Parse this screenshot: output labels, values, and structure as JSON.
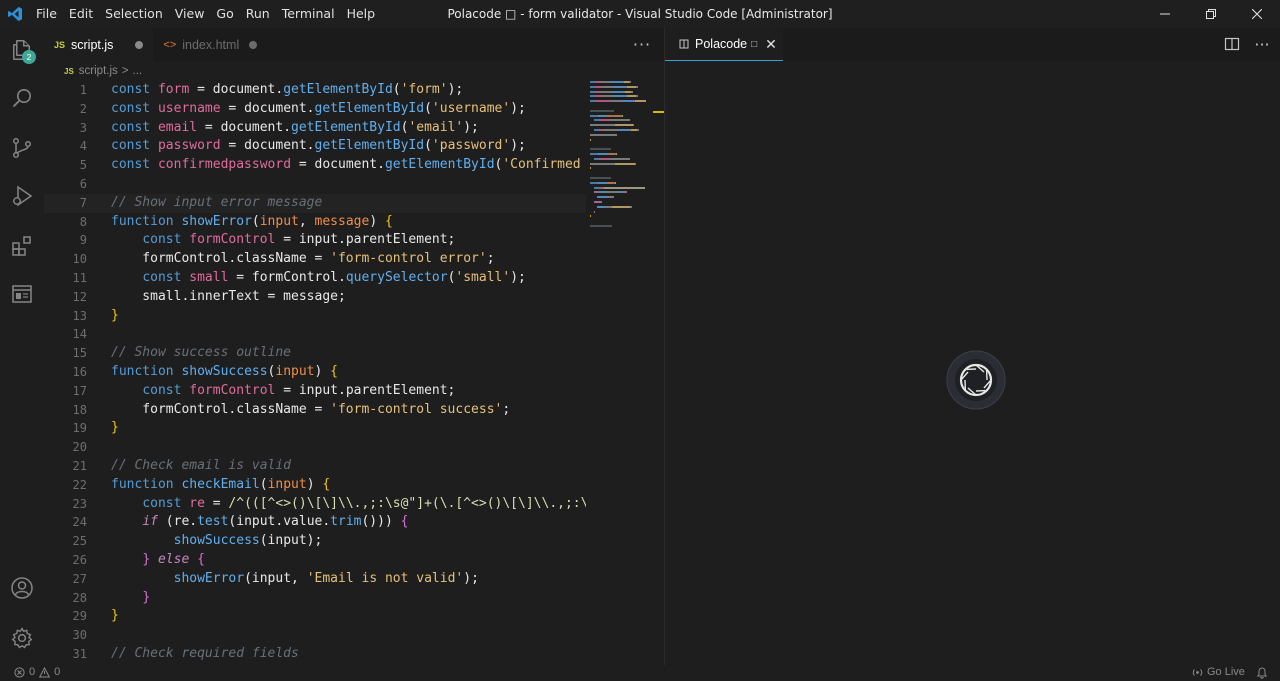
{
  "titlebar": {
    "menu": [
      "File",
      "Edit",
      "Selection",
      "View",
      "Go",
      "Run",
      "Terminal",
      "Help"
    ],
    "window_title": "Polacode □ - form validator - Visual Studio Code [Administrator]"
  },
  "activitybar": {
    "explorer_badge": "2",
    "icons": [
      "explorer-icon",
      "search-icon",
      "source-control-icon",
      "run-debug-icon",
      "extensions-icon",
      "remote-explorer-icon",
      "account-icon",
      "settings-gear-icon"
    ]
  },
  "editor_group_1": {
    "tabs": [
      {
        "glyph": "JS",
        "label": "script.js",
        "active": true,
        "modified": true
      },
      {
        "glyph": "<>",
        "label": "index.html",
        "active": false,
        "modified": true
      }
    ],
    "more_label": "···",
    "breadcrumb": {
      "glyph": "JS",
      "file": "script.js",
      "sep": ">",
      "rest": "..."
    },
    "code_lines": [
      {
        "n": "1",
        "tokens": [
          [
            "kw",
            "const "
          ],
          [
            "var",
            "form"
          ],
          [
            "plain",
            " = document."
          ],
          [
            "fn",
            "getElementById"
          ],
          [
            "plain",
            "("
          ],
          [
            "str",
            "'form'"
          ],
          [
            "plain",
            ");"
          ]
        ]
      },
      {
        "n": "2",
        "tokens": [
          [
            "kw",
            "const "
          ],
          [
            "var",
            "username"
          ],
          [
            "plain",
            " = document."
          ],
          [
            "fn",
            "getElementById"
          ],
          [
            "plain",
            "("
          ],
          [
            "str",
            "'username'"
          ],
          [
            "plain",
            ");"
          ]
        ]
      },
      {
        "n": "3",
        "tokens": [
          [
            "kw",
            "const "
          ],
          [
            "var",
            "email"
          ],
          [
            "plain",
            " = document."
          ],
          [
            "fn",
            "getElementById"
          ],
          [
            "plain",
            "("
          ],
          [
            "str",
            "'email'"
          ],
          [
            "plain",
            ");"
          ]
        ]
      },
      {
        "n": "4",
        "tokens": [
          [
            "kw",
            "const "
          ],
          [
            "var",
            "password"
          ],
          [
            "plain",
            " = document."
          ],
          [
            "fn",
            "getElementById"
          ],
          [
            "plain",
            "("
          ],
          [
            "str",
            "'password'"
          ],
          [
            "plain",
            ");"
          ]
        ]
      },
      {
        "n": "5",
        "tokens": [
          [
            "kw",
            "const "
          ],
          [
            "var",
            "confirmedpassword"
          ],
          [
            "plain",
            " = document."
          ],
          [
            "fn",
            "getElementById"
          ],
          [
            "plain",
            "("
          ],
          [
            "str",
            "'Confirmed p"
          ]
        ]
      },
      {
        "n": "6",
        "tokens": []
      },
      {
        "n": "7",
        "current": true,
        "tokens": [
          [
            "cmt",
            "// Show input error message"
          ]
        ]
      },
      {
        "n": "8",
        "tokens": [
          [
            "kw",
            "function "
          ],
          [
            "fn",
            "showError"
          ],
          [
            "plain",
            "("
          ],
          [
            "param",
            "input"
          ],
          [
            "plain",
            ", "
          ],
          [
            "param",
            "message"
          ],
          [
            "plain",
            ") "
          ],
          [
            "brace",
            "{"
          ]
        ]
      },
      {
        "n": "9",
        "tokens": [
          [
            "plain",
            "    "
          ],
          [
            "kw",
            "const "
          ],
          [
            "var",
            "formControl"
          ],
          [
            "plain",
            " = input.parentElement;"
          ]
        ]
      },
      {
        "n": "10",
        "tokens": [
          [
            "plain",
            "    formControl.className = "
          ],
          [
            "str",
            "'form-control error'"
          ],
          [
            "plain",
            ";"
          ]
        ]
      },
      {
        "n": "11",
        "tokens": [
          [
            "plain",
            "    "
          ],
          [
            "kw",
            "const "
          ],
          [
            "var",
            "small"
          ],
          [
            "plain",
            " = formControl."
          ],
          [
            "fn",
            "querySelector"
          ],
          [
            "plain",
            "("
          ],
          [
            "str",
            "'small'"
          ],
          [
            "plain",
            ");"
          ]
        ]
      },
      {
        "n": "12",
        "tokens": [
          [
            "plain",
            "    small.innerText = message;"
          ]
        ]
      },
      {
        "n": "13",
        "tokens": [
          [
            "brace",
            "}"
          ]
        ]
      },
      {
        "n": "14",
        "tokens": []
      },
      {
        "n": "15",
        "tokens": [
          [
            "cmt",
            "// Show success outline"
          ]
        ]
      },
      {
        "n": "16",
        "tokens": [
          [
            "kw",
            "function "
          ],
          [
            "fn",
            "showSuccess"
          ],
          [
            "plain",
            "("
          ],
          [
            "param",
            "input"
          ],
          [
            "plain",
            ") "
          ],
          [
            "brace",
            "{"
          ]
        ]
      },
      {
        "n": "17",
        "tokens": [
          [
            "plain",
            "    "
          ],
          [
            "kw",
            "const "
          ],
          [
            "var",
            "formControl"
          ],
          [
            "plain",
            " = input.parentElement;"
          ]
        ]
      },
      {
        "n": "18",
        "tokens": [
          [
            "plain",
            "    formControl.className = "
          ],
          [
            "str",
            "'form-control success'"
          ],
          [
            "plain",
            ";"
          ]
        ]
      },
      {
        "n": "19",
        "tokens": [
          [
            "brace",
            "}"
          ]
        ]
      },
      {
        "n": "20",
        "tokens": []
      },
      {
        "n": "21",
        "tokens": [
          [
            "cmt",
            "// Check email is valid"
          ]
        ]
      },
      {
        "n": "22",
        "tokens": [
          [
            "kw",
            "function "
          ],
          [
            "fn",
            "checkEmail"
          ],
          [
            "plain",
            "("
          ],
          [
            "param",
            "input"
          ],
          [
            "plain",
            ") "
          ],
          [
            "brace",
            "{"
          ]
        ]
      },
      {
        "n": "23",
        "tokens": [
          [
            "plain",
            "    "
          ],
          [
            "kw",
            "const "
          ],
          [
            "var",
            "re"
          ],
          [
            "plain",
            " = "
          ],
          [
            "regex",
            "/^(([^<>()\\[\\]\\\\.,;:\\s@\"]+(\\.[^<>()\\[\\]\\\\.,;:\\"
          ]
        ]
      },
      {
        "n": "24",
        "tokens": [
          [
            "plain",
            "    "
          ],
          [
            "ctl",
            "if "
          ],
          [
            "plain",
            "(re."
          ],
          [
            "fn",
            "test"
          ],
          [
            "plain",
            "(input.value."
          ],
          [
            "fn",
            "trim"
          ],
          [
            "plain",
            "())) "
          ],
          [
            "brace2",
            "{"
          ]
        ]
      },
      {
        "n": "25",
        "tokens": [
          [
            "plain",
            "        "
          ],
          [
            "fn",
            "showSuccess"
          ],
          [
            "plain",
            "(input);"
          ]
        ]
      },
      {
        "n": "26",
        "tokens": [
          [
            "plain",
            "    "
          ],
          [
            "brace2",
            "} "
          ],
          [
            "ctl",
            "else "
          ],
          [
            "brace2",
            "{"
          ]
        ]
      },
      {
        "n": "27",
        "tokens": [
          [
            "plain",
            "        "
          ],
          [
            "fn",
            "showError"
          ],
          [
            "plain",
            "(input, "
          ],
          [
            "str",
            "'Email is not valid'"
          ],
          [
            "plain",
            ");"
          ]
        ]
      },
      {
        "n": "28",
        "tokens": [
          [
            "plain",
            "    "
          ],
          [
            "brace2",
            "}"
          ]
        ]
      },
      {
        "n": "29",
        "tokens": [
          [
            "brace",
            "}"
          ]
        ]
      },
      {
        "n": "30",
        "tokens": []
      },
      {
        "n": "31",
        "tokens": [
          [
            "cmt",
            "// Check required fields"
          ]
        ]
      }
    ]
  },
  "editor_group_2": {
    "tab_label": "Polacode",
    "close_glyph": "✕",
    "more_label": "···"
  },
  "statusbar": {
    "errors": "0",
    "warnings": "0",
    "go_live": "Go Live"
  },
  "colors": {
    "accent": "#3c9cd8",
    "badge": "#3ea695",
    "keyword": "#569cd6",
    "variable": "#e06c9f",
    "function": "#61afef",
    "string": "#e5c07b",
    "comment": "#6a7078"
  }
}
